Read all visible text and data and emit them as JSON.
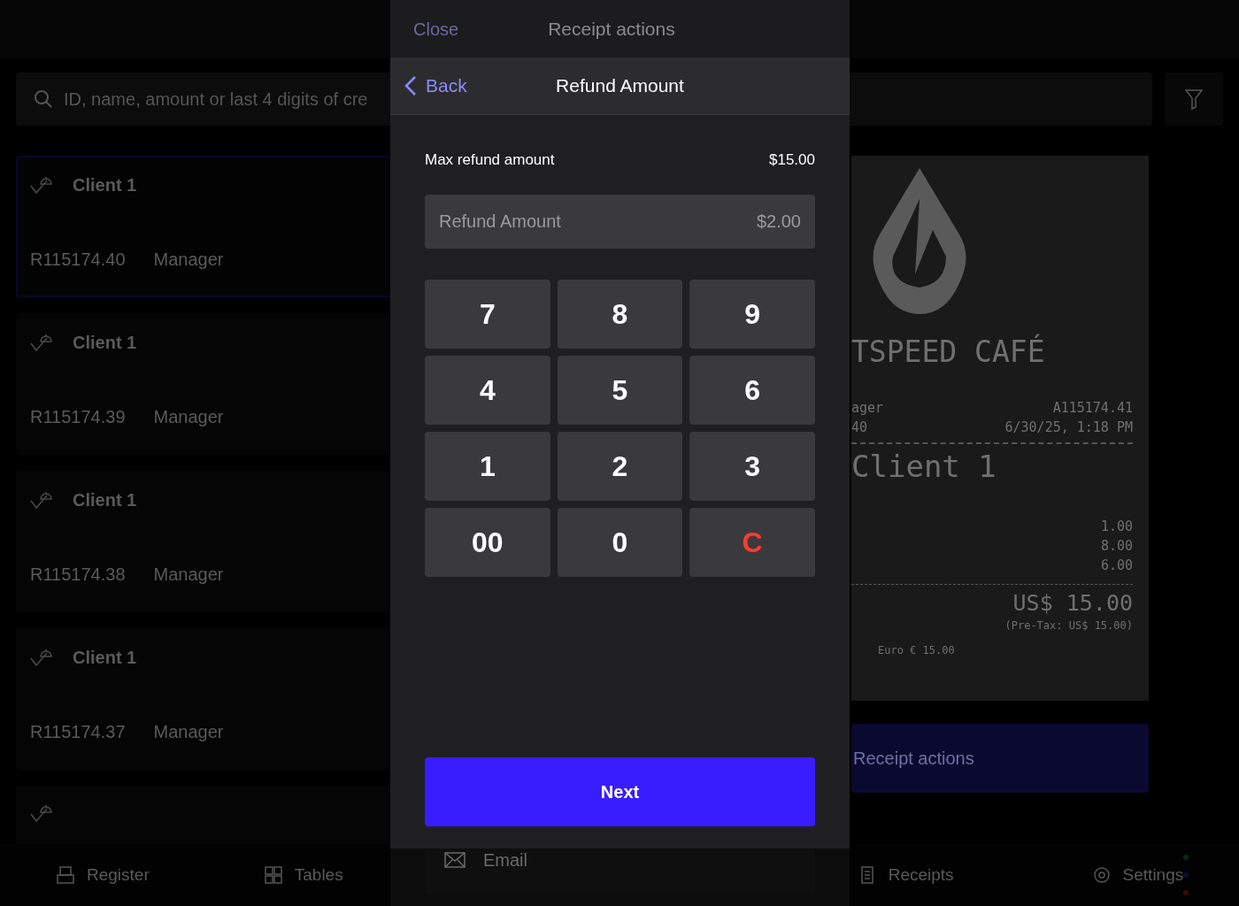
{
  "search": {
    "placeholder": "ID, name, amount or last 4 digits of cre"
  },
  "receipts": [
    {
      "client": "Client 1",
      "number": "R115174.40",
      "employee": "Manager",
      "selected": true
    },
    {
      "client": "Client 1",
      "number": "R115174.39",
      "employee": "Manager",
      "selected": false
    },
    {
      "client": "Client 1",
      "number": "R115174.38",
      "employee": "Manager",
      "selected": false
    },
    {
      "client": "Client 1",
      "number": "R115174.37",
      "employee": "Manager",
      "selected": false
    },
    {
      "selected": false
    }
  ],
  "receipt_preview": {
    "store": "TSPEED CAFÉ",
    "meta": [
      [
        "ager",
        "A115174.41"
      ],
      [
        "40",
        "6/30/25, 1:18 PM"
      ]
    ],
    "customer": "Client 1",
    "lines": [
      "1.00",
      "8.00",
      "6.00"
    ],
    "total": "US$ 15.00",
    "pretax": "(Pre-Tax: US$ 15.00)",
    "currencies": [
      "Euro € 15.00"
    ]
  },
  "receipt_actions_button": "Receipt actions",
  "bottom_nav": [
    {
      "label": "Register",
      "kind": "register"
    },
    {
      "label": "Tables",
      "kind": "tables"
    },
    {
      "label": "Receipts",
      "kind": "receipts"
    },
    {
      "label": "Settings",
      "kind": "settings"
    }
  ],
  "sheet": {
    "close": "Close",
    "title": "Receipt actions",
    "email": "Email"
  },
  "modal": {
    "back": "Back",
    "title": "Refund Amount",
    "max_label": "Max refund amount",
    "max_value": "$15.00",
    "field_label": "Refund Amount",
    "field_value": "$2.00",
    "keys": [
      {
        "label": "7",
        "kind": "digit"
      },
      {
        "label": "8",
        "kind": "digit"
      },
      {
        "label": "9",
        "kind": "digit"
      },
      {
        "label": "4",
        "kind": "digit"
      },
      {
        "label": "5",
        "kind": "digit"
      },
      {
        "label": "6",
        "kind": "digit"
      },
      {
        "label": "1",
        "kind": "digit"
      },
      {
        "label": "2",
        "kind": "digit"
      },
      {
        "label": "3",
        "kind": "digit"
      },
      {
        "label": "00",
        "kind": "digit"
      },
      {
        "label": "0",
        "kind": "digit"
      },
      {
        "label": "C",
        "kind": "clear"
      }
    ],
    "next": "Next"
  }
}
